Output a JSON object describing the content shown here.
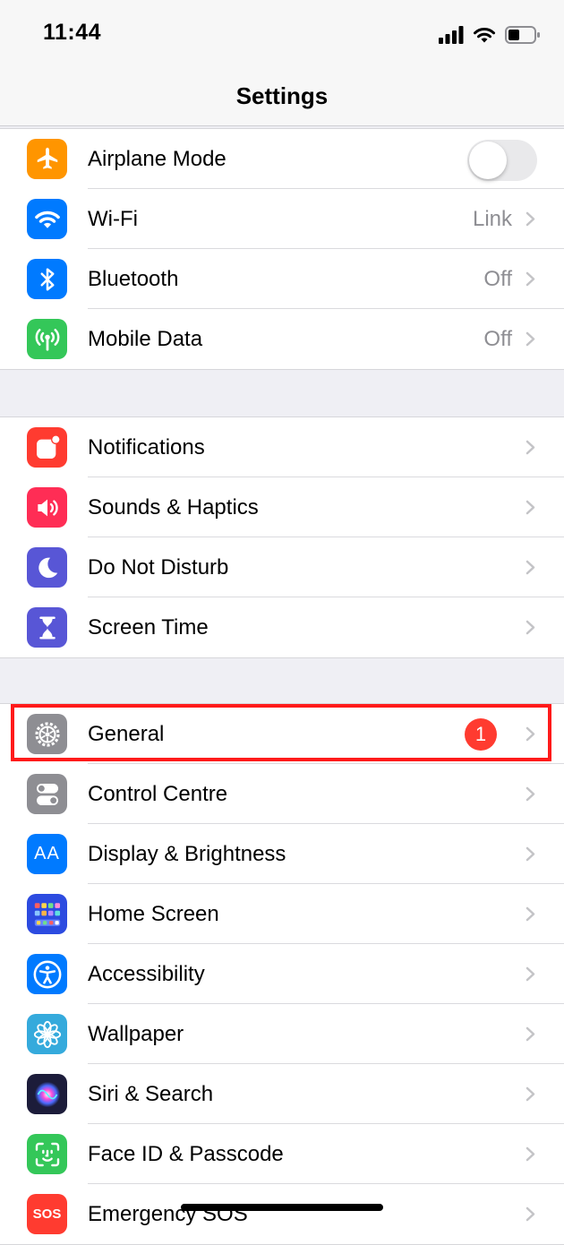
{
  "status_bar": {
    "time": "11:44"
  },
  "nav": {
    "title": "Settings"
  },
  "groups": [
    {
      "rows": [
        {
          "label": "Airplane Mode",
          "icon": "airplane-icon",
          "color": "#ff9500",
          "toggle": false
        },
        {
          "label": "Wi-Fi",
          "icon": "wifi-icon",
          "color": "#007aff",
          "value": "Link"
        },
        {
          "label": "Bluetooth",
          "icon": "bluetooth-icon",
          "color": "#007aff",
          "value": "Off"
        },
        {
          "label": "Mobile Data",
          "icon": "antenna-icon",
          "color": "#34c759",
          "value": "Off"
        }
      ]
    },
    {
      "rows": [
        {
          "label": "Notifications",
          "icon": "notifications-icon",
          "color": "#ff3b30"
        },
        {
          "label": "Sounds & Haptics",
          "icon": "speaker-icon",
          "color": "#ff2d55"
        },
        {
          "label": "Do Not Disturb",
          "icon": "moon-icon",
          "color": "#5856d6"
        },
        {
          "label": "Screen Time",
          "icon": "hourglass-icon",
          "color": "#5856d6"
        }
      ]
    },
    {
      "rows": [
        {
          "label": "General",
          "icon": "gear-icon",
          "color": "#8e8e93",
          "badge": "1",
          "highlighted": true
        },
        {
          "label": "Control Centre",
          "icon": "toggles-icon",
          "color": "#8e8e93"
        },
        {
          "label": "Display & Brightness",
          "icon": "text-size-icon",
          "color": "#007aff",
          "icon_text": "AA"
        },
        {
          "label": "Home Screen",
          "icon": "home-grid-icon",
          "color": "#2c4be0"
        },
        {
          "label": "Accessibility",
          "icon": "accessibility-icon",
          "color": "#007aff"
        },
        {
          "label": "Wallpaper",
          "icon": "flower-icon",
          "color": "#35aadc"
        },
        {
          "label": "Siri & Search",
          "icon": "siri-icon",
          "color": "#1c1c3a"
        },
        {
          "label": "Face ID & Passcode",
          "icon": "face-id-icon",
          "color": "#34c759"
        },
        {
          "label": "Emergency SOS",
          "icon": "sos-icon",
          "color": "#ff3b30",
          "icon_text": "SOS"
        }
      ]
    }
  ]
}
